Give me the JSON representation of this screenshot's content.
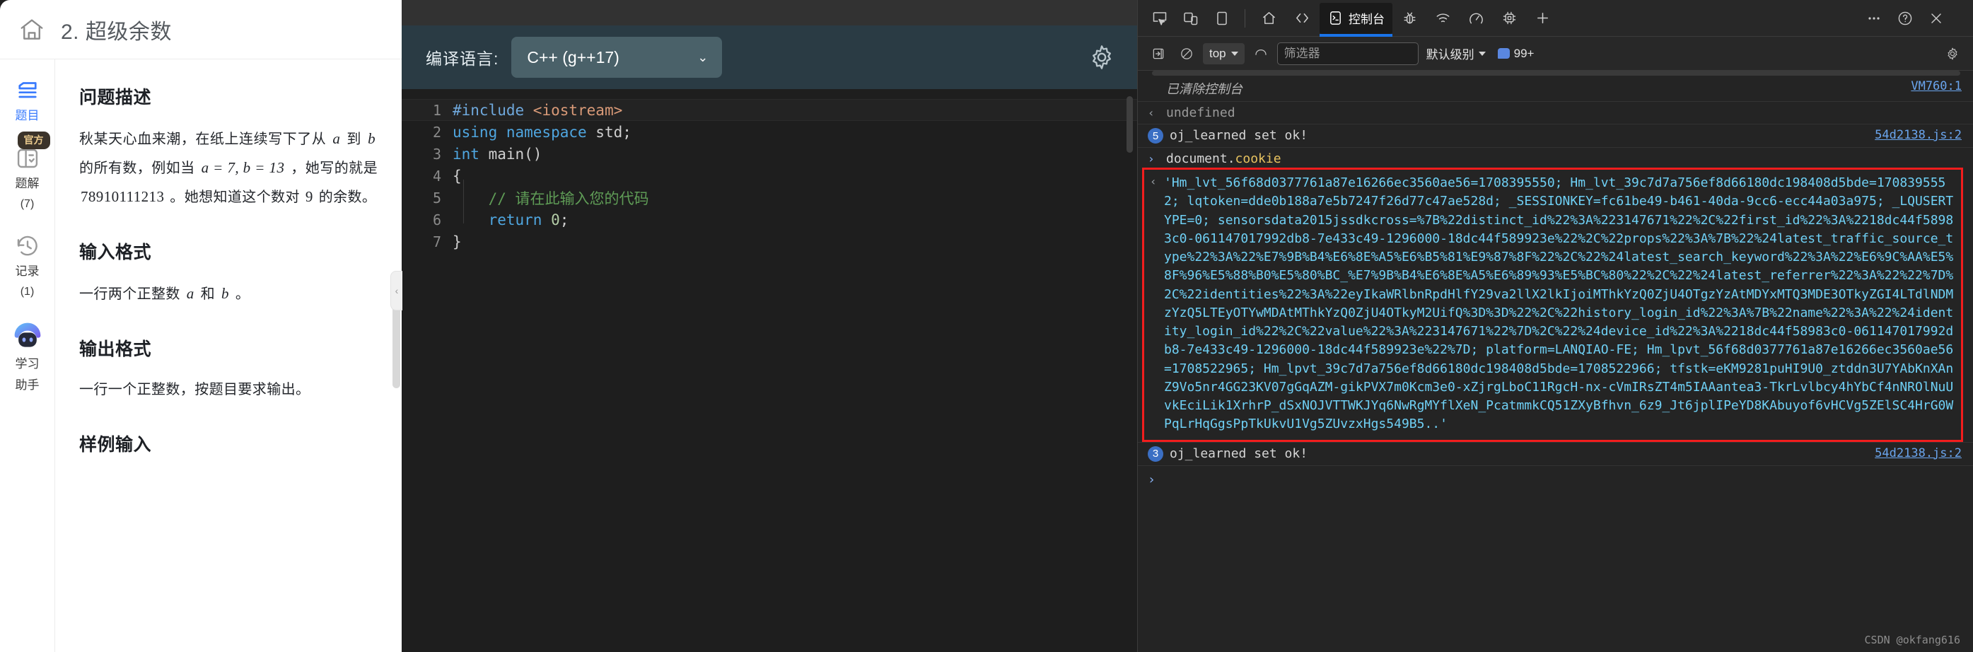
{
  "problem": {
    "home_icon": "home-icon",
    "title": "2. 超级余数",
    "rail": [
      {
        "label": "题目",
        "count": "",
        "icon": "list-icon",
        "active": true,
        "badge": ""
      },
      {
        "label": "题解",
        "count": "(7)",
        "icon": "solution-icon",
        "active": false,
        "badge": "官方"
      },
      {
        "label": "记录",
        "count": "(1)",
        "icon": "history-icon",
        "active": false,
        "badge": ""
      },
      {
        "label": "学习\n助手",
        "count": "",
        "icon": "robot-icon",
        "active": false,
        "badge": ""
      }
    ],
    "rail_items": [
      {
        "label": "题目",
        "count": ""
      },
      {
        "label": "题解",
        "count": "(7)",
        "badge": "官方"
      },
      {
        "label": "记录",
        "count": "(1)"
      },
      {
        "label1": "学习",
        "label2": "助手"
      }
    ],
    "sections": {
      "desc_heading": "问题描述",
      "desc_1": "秋某天心血来潮，在纸上连续写下了从 ",
      "desc_a": "a",
      "desc_2": " 到 ",
      "desc_b": "b",
      "desc_3": " 的所有数，例如当 ",
      "desc_eq": "a = 7, b = 13",
      "desc_4": " ，她写的就是 ",
      "desc_num": "78910111213",
      "desc_5": " 。她想知道这个数对 ",
      "desc_nine": "9",
      "desc_6": " 的余数。",
      "input_heading": "输入格式",
      "input_p1": "一行两个正整数 ",
      "input_a": "a",
      "input_p2": " 和 ",
      "input_b": "b",
      "input_p3": " 。",
      "output_heading": "输出格式",
      "output_p": "一行一个正整数，按题目要求输出。",
      "sample_heading": "样例输入"
    },
    "collapse_icon": "chevron-left-icon"
  },
  "editor": {
    "lang_label": "编译语言:",
    "lang_value": "C++ (g++17)",
    "chevron": "⌄",
    "settings_icon": "gear-icon",
    "lines": [
      {
        "n": "1",
        "current": true,
        "tokens": [
          {
            "t": "#include ",
            "c": "c-pp"
          },
          {
            "t": "<iostream>",
            "c": "c-str"
          }
        ]
      },
      {
        "n": "2",
        "current": false,
        "tokens": [
          {
            "t": "using namespace ",
            "c": "c-kw"
          },
          {
            "t": "std;",
            "c": "c-id"
          }
        ]
      },
      {
        "n": "3",
        "current": false,
        "tokens": [
          {
            "t": "int ",
            "c": "c-kw"
          },
          {
            "t": "main()",
            "c": "c-id"
          }
        ]
      },
      {
        "n": "4",
        "current": false,
        "tokens": [
          {
            "t": "{",
            "c": "c-id"
          }
        ]
      },
      {
        "n": "5",
        "current": false,
        "tokens": [
          {
            "t": "    // 请在此输入您的代码",
            "c": "c-cmt"
          }
        ]
      },
      {
        "n": "6",
        "current": false,
        "tokens": [
          {
            "t": "    ",
            "c": "c-id"
          },
          {
            "t": "return ",
            "c": "c-kw"
          },
          {
            "t": "0",
            "c": "c-num"
          },
          {
            "t": ";",
            "c": "c-id"
          }
        ]
      },
      {
        "n": "7",
        "current": false,
        "tokens": [
          {
            "t": "}",
            "c": "c-id"
          }
        ]
      }
    ]
  },
  "devtools": {
    "toolbar": {
      "inspect_icon": "inspect-element-icon",
      "device_icon": "device-toolbar-icon",
      "dock_icon": "dock-panel-icon",
      "tabs": [
        {
          "label": "",
          "icon": "home-icon",
          "active": false
        },
        {
          "label": "",
          "icon": "source-code-icon",
          "active": false
        },
        {
          "label": "控制台",
          "icon": "console-icon",
          "active": true
        },
        {
          "label": "",
          "icon": "bug-icon",
          "active": false
        },
        {
          "label": "",
          "icon": "network-icon",
          "active": false
        },
        {
          "label": "",
          "icon": "performance-icon",
          "active": false
        },
        {
          "label": "",
          "icon": "memory-chip-icon",
          "active": false
        },
        {
          "label": "",
          "icon": "plus-icon",
          "active": false
        }
      ],
      "more_icon": "more-options-icon",
      "help_icon": "help-icon",
      "close_icon": "close-icon"
    },
    "filterbar": {
      "sidebar_icon": "show-sidebar-icon",
      "clear_icon": "clear-console-icon",
      "context_value": "top",
      "eye_icon": "live-expression-icon",
      "filter_placeholder": "筛选器",
      "filter_value": "",
      "level_label": "默认级别",
      "message_count": "99+",
      "settings_icon": "gear-icon"
    },
    "console": {
      "cleared_text": "已清除控制台",
      "cleared_source": "VM760:1",
      "undefined_text": "undefined",
      "log1_count": "5",
      "log1_text": "oj_learned set ok!",
      "log1_source": "54d2138.js:2",
      "input_expr_prefix": "document.",
      "input_expr_prop": "cookie",
      "cookie_value": "'Hm_lvt_56f68d0377761a87e16266ec3560ae56=1708395550; Hm_lvt_39c7d7a756ef8d66180dc198408d5bde=1708395552; lqtoken=dde0b188a7e5b7247f26d77c47ae528d; _SESSIONKEY=fc61be49-b461-40da-9cc6-ecc44a03a975; _LQUSERTYPE=0; sensorsdata2015jssdkcross=%7B%22distinct_id%22%3A%223147671%22%2C%22first_id%22%3A%2218dc44f58983c0-061147017992db8-7e433c49-1296000-18dc44f589923e%22%2C%22props%22%3A%7B%22%24latest_traffic_source_type%22%3A%22%E7%9B%B4%E6%8E%A5%E6%B5%81%E9%87%8F%22%2C%22%24latest_search_keyword%22%3A%22%E6%9C%AA%E5%8F%96%E5%88%B0%E5%80%BC_%E7%9B%B4%E6%8E%A5%E6%89%93%E5%BC%80%22%2C%22%24latest_referrer%22%3A%22%22%7D%2C%22identities%22%3A%22eyIkaWRlbnRpdHlfY29va2llX2lkIjoiMThkYzQ0ZjU4OTgzYzAtMDYxMTQ3MDE3OTkyZGI4LTdlNDMzYzQ5LTEyOTYwMDAtMThkYzQ0ZjU4OTkyM2UifQ%3D%3D%22%2C%22history_login_id%22%3A%7B%22name%22%3A%22%24identity_login_id%22%2C%22value%22%3A%223147671%22%7D%2C%22%24device_id%22%3A%2218dc44f58983c0-061147017992db8-7e433c49-1296000-18dc44f589923e%22%7D; platform=LANQIAO-FE; Hm_lpvt_56f68d0377761a87e16266ec3560ae56=1708522965; Hm_lpvt_39c7d7a756ef8d66180dc198408d5bde=1708522966; tfstk=eKM9281puHI9U0_ztddn3U7YAbKnXAnZ9Vo5nr4GG23KV07gGqAZM-gikPVX7m0Kcm3e0-xZjrgLboC11RgcH-nx-cVmIRsZT4m5IAAantea3-TkrLvlbcy4hYbCf4nNROlNuUvkEciLik1XrhrP_dSxNOJVTTWKJYq6NwRgMYflXeN_PcatmmkCQ51ZXyBfhvn_6z9_Jt6jplIPeYD8KAbuyof6vHCVg5ZElSC4HrG0WPqLrHqGgsPpTkUkvU1Vg5ZUvzxHgs549B5..'",
      "log2_count": "3",
      "log2_text": "oj_learned set ok!",
      "log2_source": "54d2138.js:2",
      "watermark": "CSDN @okfang616"
    }
  }
}
